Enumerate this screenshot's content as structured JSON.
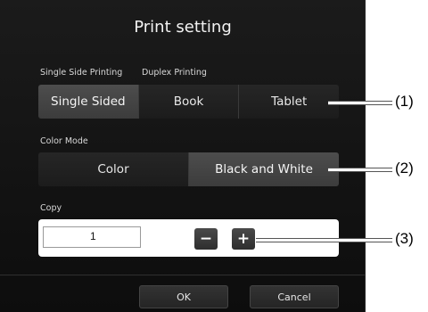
{
  "dialog": {
    "title": "Print setting",
    "print_mode": {
      "label_single": "Single Side Printing",
      "label_duplex": "Duplex Printing",
      "options": [
        "Single Sided",
        "Book",
        "Tablet"
      ],
      "selected": "Single Sided"
    },
    "color_mode": {
      "label": "Color Mode",
      "options": [
        "Color",
        "Black and White"
      ],
      "selected": "Black and White"
    },
    "copy": {
      "label": "Copy",
      "value": "1",
      "minus": "−",
      "plus": "+"
    },
    "footer": {
      "ok": "OK",
      "cancel": "Cancel"
    }
  },
  "callouts": [
    "(1)",
    "(2)",
    "(3)"
  ],
  "colors": {
    "dialog_bg": "#141414",
    "selected_option": "#454545",
    "unselected_option": "#222222",
    "text": "#e8e8e8"
  }
}
